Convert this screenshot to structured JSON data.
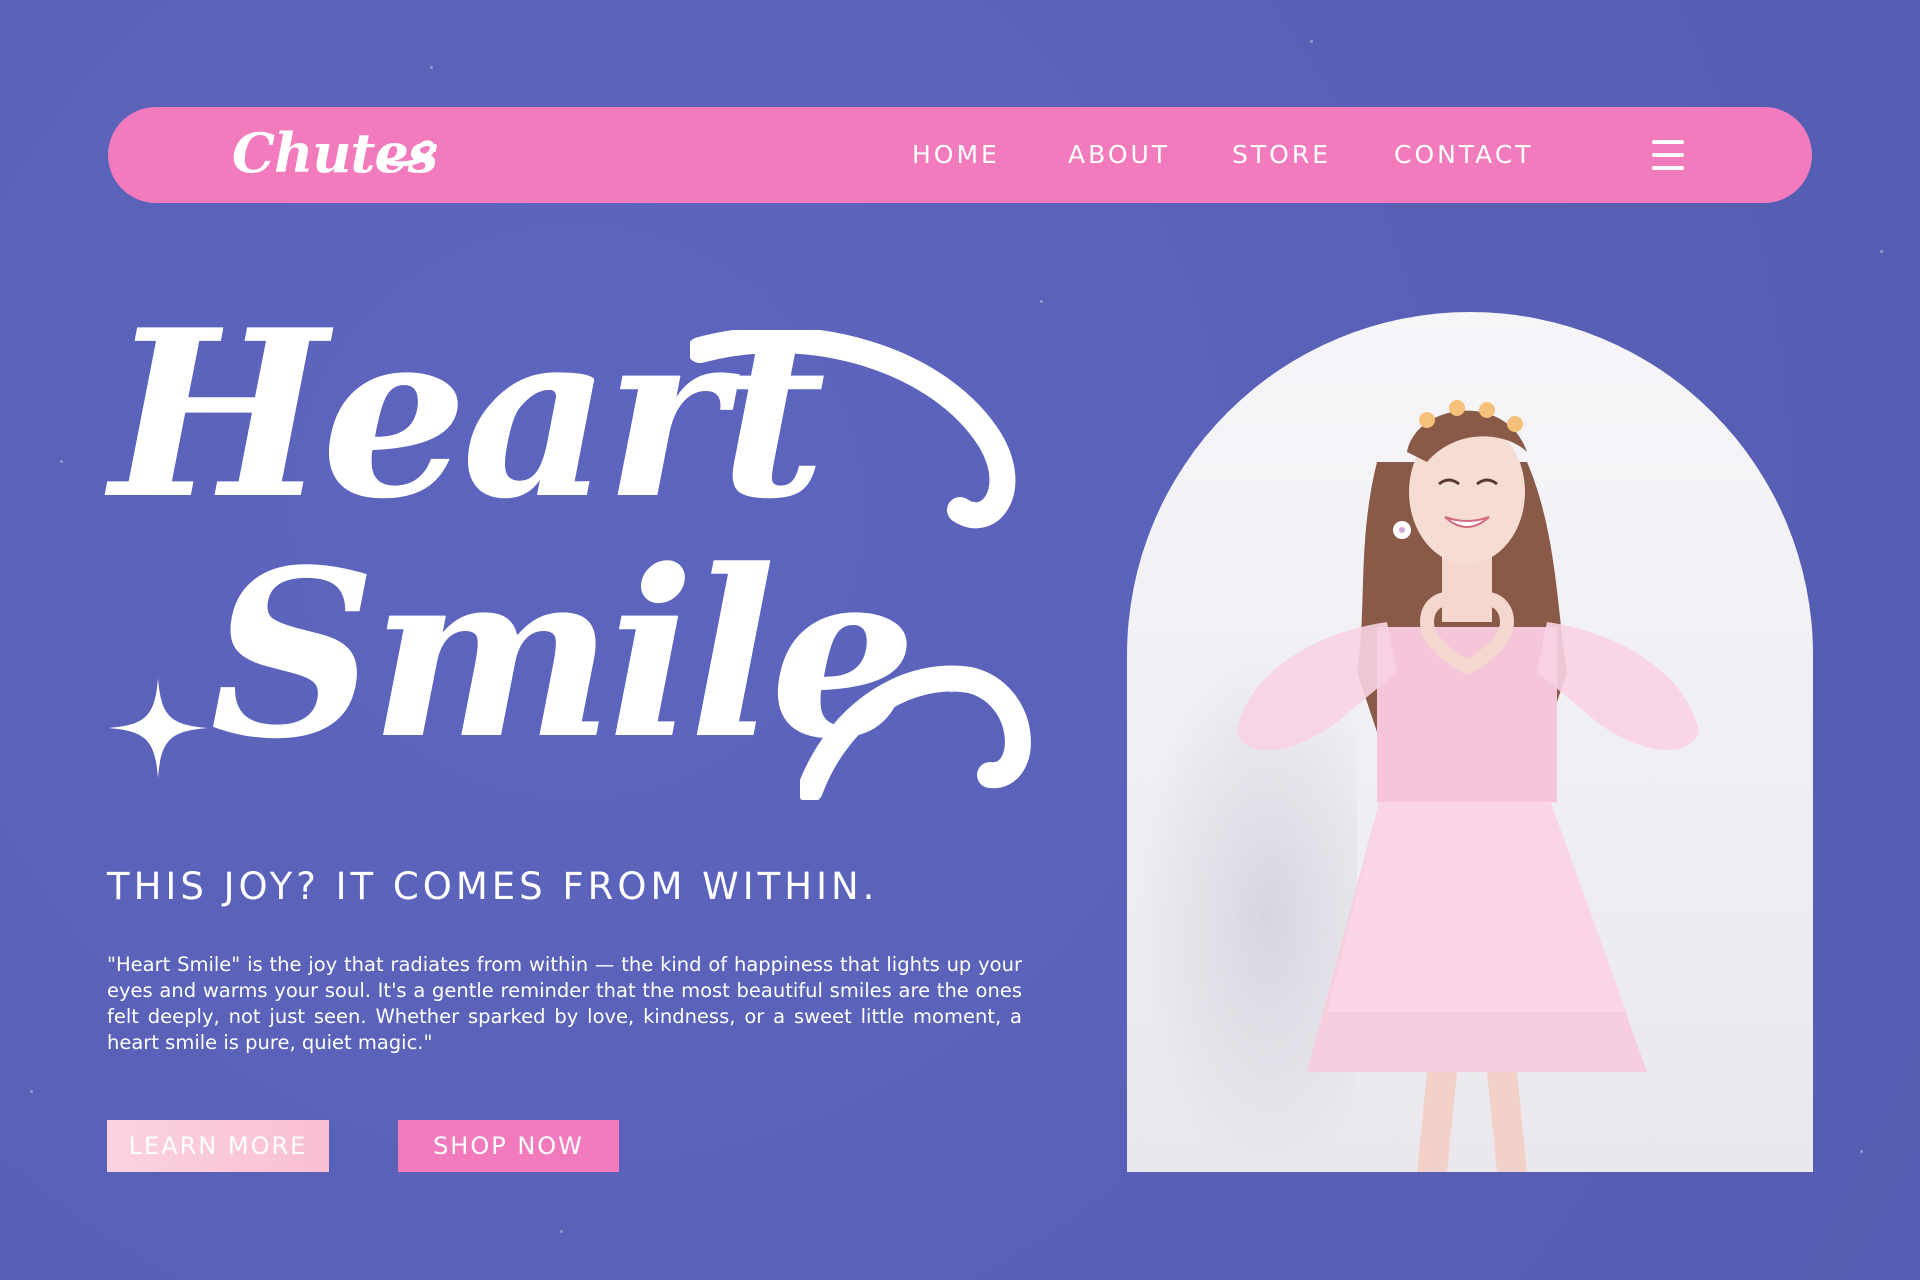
{
  "colors": {
    "background": "#5a62ba",
    "nav_pink": "#f27bbd",
    "button_light": "#f9c6d8",
    "white": "#ffffff",
    "dress_pink": "#f7cde0"
  },
  "nav": {
    "logo": "Chutes",
    "links": [
      "HOME",
      "ABOUT",
      "STORE",
      "CONTACT"
    ],
    "menu_icon": "hamburger-menu-icon"
  },
  "hero": {
    "title_line_1": "Heart",
    "title_line_2": "Smile",
    "sparkle_icon": "sparkle-icon",
    "tagline": "THIS JOY? IT COMES FROM WITHIN.",
    "description": "\"Heart Smile\" is the joy that radiates from within — the kind of happiness that lights up your eyes and warms your soul. It's a gentle reminder that the most beautiful smiles are the ones felt deeply, not just seen. Whether sparked by love, kindness, or a sweet little moment, a heart smile is pure, quiet magic.\"",
    "buttons": {
      "learn_more": "LEARN MORE",
      "shop_now": "SHOP NOW"
    }
  }
}
